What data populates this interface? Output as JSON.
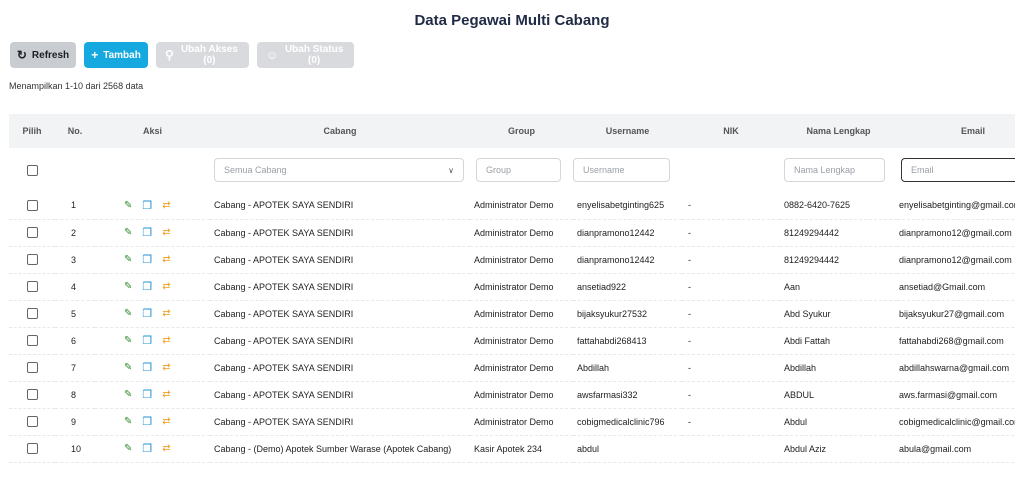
{
  "page": {
    "title": "Data Pegawai Multi Cabang"
  },
  "toolbar": {
    "refresh_label": "Refresh",
    "add_label": "Tambah",
    "access_label": "Ubah Akses (0)",
    "status_label": "Ubah Status (0)"
  },
  "info": {
    "showing": "Menampilkan 1-10 dari 2568 data"
  },
  "table": {
    "headers": {
      "pilih": "Pilih",
      "no": "No.",
      "aksi": "Aksi",
      "cabang": "Cabang",
      "group": "Group",
      "username": "Username",
      "nik": "NIK",
      "nama": "Nama Lengkap",
      "email": "Email"
    },
    "filters": {
      "cabang_selected": "Semua Cabang",
      "group_placeholder": "Group",
      "username_placeholder": "Username",
      "nama_placeholder": "Nama Lengkap",
      "email_placeholder": "Email"
    },
    "rows": [
      {
        "no": "1",
        "cabang": "Cabang - APOTEK SAYA SENDIRI",
        "group": "Administrator Demo",
        "username": "enyelisabetginting625",
        "nik": "-",
        "nama": "0882-6420-7625",
        "email": "enyelisabetginting@gmail.com"
      },
      {
        "no": "2",
        "cabang": "Cabang - APOTEK SAYA SENDIRI",
        "group": "Administrator Demo",
        "username": "dianpramono12442",
        "nik": "-",
        "nama": "81249294442",
        "email": "dianpramono12@gmail.com"
      },
      {
        "no": "3",
        "cabang": "Cabang - APOTEK SAYA SENDIRI",
        "group": "Administrator Demo",
        "username": "dianpramono12442",
        "nik": "-",
        "nama": "81249294442",
        "email": "dianpramono12@gmail.com"
      },
      {
        "no": "4",
        "cabang": "Cabang - APOTEK SAYA SENDIRI",
        "group": "Administrator Demo",
        "username": "ansetiad922",
        "nik": "-",
        "nama": "Aan",
        "email": "ansetiad@Gmail.com"
      },
      {
        "no": "5",
        "cabang": "Cabang - APOTEK SAYA SENDIRI",
        "group": "Administrator Demo",
        "username": "bijaksyukur27532",
        "nik": "-",
        "nama": "Abd Syukur",
        "email": "bijaksyukur27@gmail.com"
      },
      {
        "no": "6",
        "cabang": "Cabang - APOTEK SAYA SENDIRI",
        "group": "Administrator Demo",
        "username": "fattahabdi268413",
        "nik": "-",
        "nama": "Abdi Fattah",
        "email": "fattahabdi268@gmail.com"
      },
      {
        "no": "7",
        "cabang": "Cabang - APOTEK SAYA SENDIRI",
        "group": "Administrator Demo",
        "username": "Abdillah",
        "nik": "-",
        "nama": "Abdillah",
        "email": "abdillahswarna@gmail.com"
      },
      {
        "no": "8",
        "cabang": "Cabang - APOTEK SAYA SENDIRI",
        "group": "Administrator Demo",
        "username": "awsfarmasi332",
        "nik": "-",
        "nama": "ABDUL",
        "email": "aws.farmasi@gmail.com"
      },
      {
        "no": "9",
        "cabang": "Cabang - APOTEK SAYA SENDIRI",
        "group": "Administrator Demo",
        "username": "cobigmedicalclinic796",
        "nik": "-",
        "nama": "Abdul",
        "email": "cobigmedicalclinic@gmail.com"
      },
      {
        "no": "10",
        "cabang": "Cabang - (Demo) Apotek Sumber Warase (Apotek Cabang)",
        "group": "Kasir Apotek 234",
        "username": "abdul",
        "nik": "",
        "nama": "Abdul Aziz",
        "email": "abula@gmail.com"
      }
    ]
  },
  "icons": {
    "refresh": "refresh-icon",
    "add": "plus-icon",
    "access": "user-key-icon",
    "status": "users-icon",
    "edit": "pencil-icon",
    "copy": "copy-icon",
    "swap": "swap-icon",
    "chevron": "chevron-down-icon"
  },
  "colors": {
    "primary": "#15a9e0",
    "edit": "#2e8b2e",
    "copy": "#1e90d6",
    "swap": "#f0a020"
  }
}
